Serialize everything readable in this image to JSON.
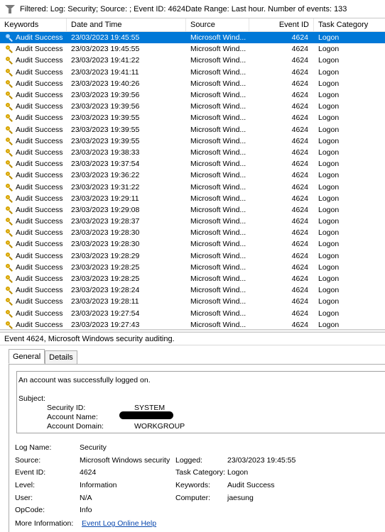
{
  "filter": {
    "text": "Filtered: Log: Security; Source: ; Event ID: 4624Date Range: Last hour. Number of events: 133"
  },
  "table": {
    "headers": {
      "keywords": "Keywords",
      "datetime": "Date and Time",
      "source": "Source",
      "event_id": "Event ID",
      "category": "Task Category"
    },
    "rows": [
      {
        "keywords": "Audit Success",
        "datetime": "23/03/2023 19:45:55",
        "source": "Microsoft Wind...",
        "event_id": "4624",
        "category": "Logon"
      },
      {
        "keywords": "Audit Success",
        "datetime": "23/03/2023 19:45:55",
        "source": "Microsoft Wind...",
        "event_id": "4624",
        "category": "Logon"
      },
      {
        "keywords": "Audit Success",
        "datetime": "23/03/2023 19:41:22",
        "source": "Microsoft Wind...",
        "event_id": "4624",
        "category": "Logon"
      },
      {
        "keywords": "Audit Success",
        "datetime": "23/03/2023 19:41:11",
        "source": "Microsoft Wind...",
        "event_id": "4624",
        "category": "Logon"
      },
      {
        "keywords": "Audit Success",
        "datetime": "23/03/2023 19:40:26",
        "source": "Microsoft Wind...",
        "event_id": "4624",
        "category": "Logon"
      },
      {
        "keywords": "Audit Success",
        "datetime": "23/03/2023 19:39:56",
        "source": "Microsoft Wind...",
        "event_id": "4624",
        "category": "Logon"
      },
      {
        "keywords": "Audit Success",
        "datetime": "23/03/2023 19:39:56",
        "source": "Microsoft Wind...",
        "event_id": "4624",
        "category": "Logon"
      },
      {
        "keywords": "Audit Success",
        "datetime": "23/03/2023 19:39:55",
        "source": "Microsoft Wind...",
        "event_id": "4624",
        "category": "Logon"
      },
      {
        "keywords": "Audit Success",
        "datetime": "23/03/2023 19:39:55",
        "source": "Microsoft Wind...",
        "event_id": "4624",
        "category": "Logon"
      },
      {
        "keywords": "Audit Success",
        "datetime": "23/03/2023 19:39:55",
        "source": "Microsoft Wind...",
        "event_id": "4624",
        "category": "Logon"
      },
      {
        "keywords": "Audit Success",
        "datetime": "23/03/2023 19:38:33",
        "source": "Microsoft Wind...",
        "event_id": "4624",
        "category": "Logon"
      },
      {
        "keywords": "Audit Success",
        "datetime": "23/03/2023 19:37:54",
        "source": "Microsoft Wind...",
        "event_id": "4624",
        "category": "Logon"
      },
      {
        "keywords": "Audit Success",
        "datetime": "23/03/2023 19:36:22",
        "source": "Microsoft Wind...",
        "event_id": "4624",
        "category": "Logon"
      },
      {
        "keywords": "Audit Success",
        "datetime": "23/03/2023 19:31:22",
        "source": "Microsoft Wind...",
        "event_id": "4624",
        "category": "Logon"
      },
      {
        "keywords": "Audit Success",
        "datetime": "23/03/2023 19:29:11",
        "source": "Microsoft Wind...",
        "event_id": "4624",
        "category": "Logon"
      },
      {
        "keywords": "Audit Success",
        "datetime": "23/03/2023 19:29:08",
        "source": "Microsoft Wind...",
        "event_id": "4624",
        "category": "Logon"
      },
      {
        "keywords": "Audit Success",
        "datetime": "23/03/2023 19:28:37",
        "source": "Microsoft Wind...",
        "event_id": "4624",
        "category": "Logon"
      },
      {
        "keywords": "Audit Success",
        "datetime": "23/03/2023 19:28:30",
        "source": "Microsoft Wind...",
        "event_id": "4624",
        "category": "Logon"
      },
      {
        "keywords": "Audit Success",
        "datetime": "23/03/2023 19:28:30",
        "source": "Microsoft Wind...",
        "event_id": "4624",
        "category": "Logon"
      },
      {
        "keywords": "Audit Success",
        "datetime": "23/03/2023 19:28:29",
        "source": "Microsoft Wind...",
        "event_id": "4624",
        "category": "Logon"
      },
      {
        "keywords": "Audit Success",
        "datetime": "23/03/2023 19:28:25",
        "source": "Microsoft Wind...",
        "event_id": "4624",
        "category": "Logon"
      },
      {
        "keywords": "Audit Success",
        "datetime": "23/03/2023 19:28:25",
        "source": "Microsoft Wind...",
        "event_id": "4624",
        "category": "Logon"
      },
      {
        "keywords": "Audit Success",
        "datetime": "23/03/2023 19:28:24",
        "source": "Microsoft Wind...",
        "event_id": "4624",
        "category": "Logon"
      },
      {
        "keywords": "Audit Success",
        "datetime": "23/03/2023 19:28:11",
        "source": "Microsoft Wind...",
        "event_id": "4624",
        "category": "Logon"
      },
      {
        "keywords": "Audit Success",
        "datetime": "23/03/2023 19:27:54",
        "source": "Microsoft Wind...",
        "event_id": "4624",
        "category": "Logon"
      },
      {
        "keywords": "Audit Success",
        "datetime": "23/03/2023 19:27:43",
        "source": "Microsoft Wind...",
        "event_id": "4624",
        "category": "Logon"
      }
    ]
  },
  "detail": {
    "header": "Event 4624, Microsoft Windows security auditing.",
    "tabs": [
      {
        "label": "General"
      },
      {
        "label": "Details"
      }
    ],
    "description": {
      "message": "An account was successfully logged on.",
      "subject_label": "Subject:",
      "security_id_label": "Security ID:",
      "security_id_value": "SYSTEM",
      "account_name_label": "Account Name:",
      "account_domain_label": "Account Domain:",
      "account_domain_value": "WORKGROUP"
    },
    "fields": {
      "log_name_label": "Log Name:",
      "log_name_value": "Security",
      "source_label": "Source:",
      "source_value": "Microsoft Windows security",
      "logged_label": "Logged:",
      "logged_value": "23/03/2023 19:45:55",
      "event_id_label": "Event ID:",
      "event_id_value": "4624",
      "task_category_label": "Task Category:",
      "task_category_value": "Logon",
      "level_label": "Level:",
      "level_value": "Information",
      "keywords_label": "Keywords:",
      "keywords_value": "Audit Success",
      "user_label": "User:",
      "user_value": "N/A",
      "computer_label": "Computer:",
      "computer_value": "jaesung",
      "opcode_label": "OpCode:",
      "opcode_value": "Info",
      "more_info_label": "More Information:",
      "more_info_link": "Event Log Online Help"
    }
  },
  "colors": {
    "selection": "#0078d7",
    "link": "#0645ad"
  }
}
